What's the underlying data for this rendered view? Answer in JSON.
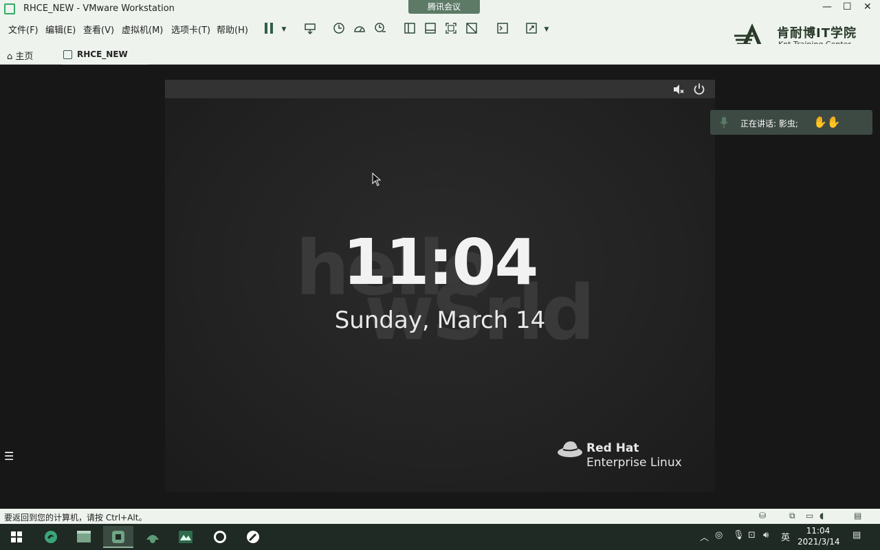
{
  "window": {
    "title": "RHCE_NEW - VMware Workstation",
    "meeting_badge": "腾讯会议",
    "minimize": "—",
    "maximize": "☐",
    "close": "✕"
  },
  "menu": {
    "items": [
      "文件(F)",
      "编辑(E)",
      "查看(V)",
      "虚拟机(M)",
      "选项卡(T)",
      "帮助(H)"
    ]
  },
  "toolbar": {
    "icons": [
      "pause-icon",
      "dropdown-icon",
      "send-keys-icon",
      "snapshot-icon",
      "restore-snapshot-icon",
      "manage-snapshots-icon",
      "sidebar-icon",
      "thumbnail-icon",
      "fullscreen-icon",
      "unity-icon",
      "console-icon",
      "stretch-icon",
      "dropdown-icon"
    ]
  },
  "logo": {
    "cn": "肯耐博IT学院",
    "en": "Knt  Training Center"
  },
  "tabs": {
    "home": "主页",
    "vm": "RHCE_NEW"
  },
  "vm": {
    "bg_text_1": "hello",
    "bg_text_2": "wSrld",
    "time": "11:04",
    "date": "Sunday, March 14",
    "brand_line1": "Red Hat",
    "brand_line2": "Enterprise Linux",
    "icons": [
      "volume-muted-icon",
      "power-icon"
    ]
  },
  "meeting": {
    "speaking_label": "正在讲话: 影虫;"
  },
  "statusbar": {
    "hint": "要返回到您的计算机，请按 Ctrl+Alt。"
  },
  "taskbar": {
    "time": "11:04",
    "date": "2021/3/14",
    "ime": "英",
    "apps": [
      "windows-start-icon",
      "edge-icon",
      "app-icon",
      "vmware-icon",
      "app-icon",
      "app-icon",
      "obs-icon",
      "app-icon"
    ]
  },
  "colors": {
    "chrome_bg": "#eef3ee",
    "vm_bg": "#222222",
    "taskbar_bg": "#1f2a24",
    "redhat_red": "#ee0000"
  }
}
